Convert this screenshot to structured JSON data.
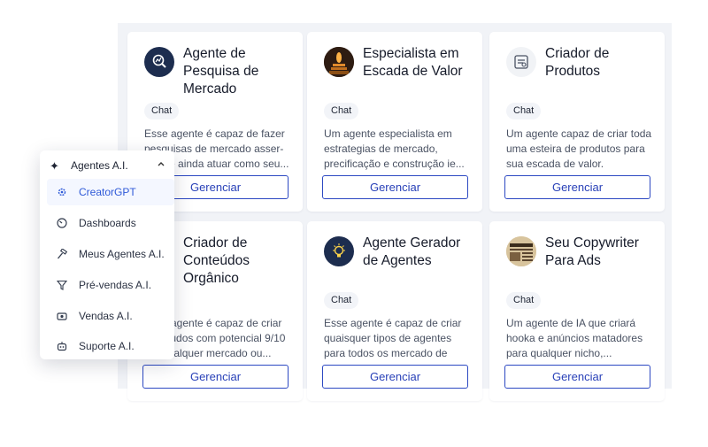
{
  "cards": [
    {
      "title": "Agente de Pesquisa de Mercado",
      "chip": "Chat",
      "description": "Esse agente é capaz de fazer pesquisas de mercado asser-tivas e ainda atuar como seu...",
      "button": "Gerenciar",
      "icon": "magnifier-graph-icon"
    },
    {
      "title": "Especialista em Escada de Valor",
      "chip": "Chat",
      "description": "Um agente especialista em estrategias de mercado, precificação e construção ie...",
      "button": "Gerenciar",
      "icon": "value-ladder-icon"
    },
    {
      "title": "Criador de Produtos",
      "chip": "Chat",
      "description": "Um agente capaz de criar toda uma esteira de produtos para sua escada de valor.",
      "button": "Gerenciar",
      "icon": "product-creator-icon"
    },
    {
      "title": "Criador de Conteúdos Orgânico",
      "chip": "",
      "description": "Esse agente é capaz de criar conteúdos com potencial 9/10 em qualquer mercado ou...",
      "button": "Gerenciar",
      "icon": "content-icon"
    },
    {
      "title": "Agente Gerador de Agentes",
      "chip": "Chat",
      "description": "Esse agente é capaz de criar quaisquer tipos de agentes para todos os mercado de",
      "button": "Gerenciar",
      "icon": "lightbulb-icon"
    },
    {
      "title": "Seu Copywriter Para Ads",
      "chip": "Chat",
      "description": "Um agente de IA que criará hooka e anúncios matadores para qualquer nicho,...",
      "button": "Gerenciar",
      "icon": "newspaper-icon"
    }
  ],
  "menu": {
    "header": "Agentes A.I.",
    "items": [
      {
        "label": "CreatorGPT",
        "icon": "cog-icon",
        "active": true
      },
      {
        "label": "Dashboards",
        "icon": "gauge-icon",
        "active": false
      },
      {
        "label": "Meus Agentes A.I.",
        "icon": "hammer-icon",
        "active": false
      },
      {
        "label": "Pré-vendas A.I.",
        "icon": "funnel-icon",
        "active": false
      },
      {
        "label": "Vendas A.I.",
        "icon": "money-icon",
        "active": false
      },
      {
        "label": "Suporte A.I.",
        "icon": "bot-icon",
        "active": false
      }
    ]
  },
  "colors": {
    "accent": "#2c48c2",
    "panel_bg": "#f1f3f7",
    "active_item": "#2f5ad8"
  }
}
